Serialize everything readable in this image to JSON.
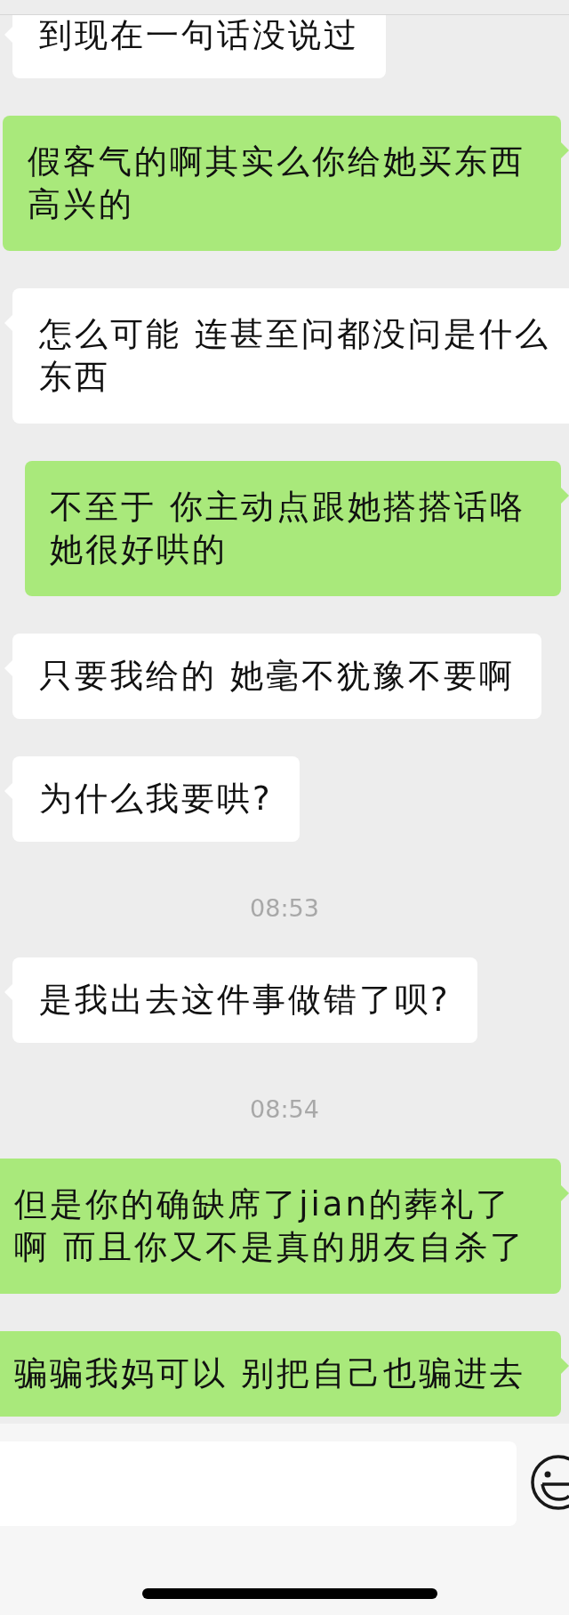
{
  "messages": [
    {
      "kind": "received",
      "lines": [
        "到现在一句话没说过"
      ]
    },
    {
      "kind": "sent",
      "lines": [
        "假客气的啊其实么你给她买东西",
        "高兴的"
      ]
    },
    {
      "kind": "received",
      "lines": [
        "怎么可能 连甚至问都没问是什么",
        "东西"
      ]
    },
    {
      "kind": "sent",
      "lines": [
        "不至于 你主动点跟她搭搭话咯",
        "她很好哄的"
      ]
    },
    {
      "kind": "received",
      "lines": [
        "只要我给的 她毫不犹豫不要啊"
      ]
    },
    {
      "kind": "received",
      "lines": [
        "为什么我要哄?"
      ]
    },
    {
      "kind": "time",
      "text": "08:53"
    },
    {
      "kind": "received",
      "lines": [
        "是我出去这件事做错了呗?"
      ]
    },
    {
      "kind": "time",
      "text": "08:54"
    },
    {
      "kind": "sent",
      "lines": [
        "但是你的确缺席了jian的葬礼了",
        "啊 而且你又不是真的朋友自杀了"
      ]
    },
    {
      "kind": "sent",
      "lines": [
        "骗骗我妈可以 别把自己也骗进去"
      ]
    }
  ]
}
